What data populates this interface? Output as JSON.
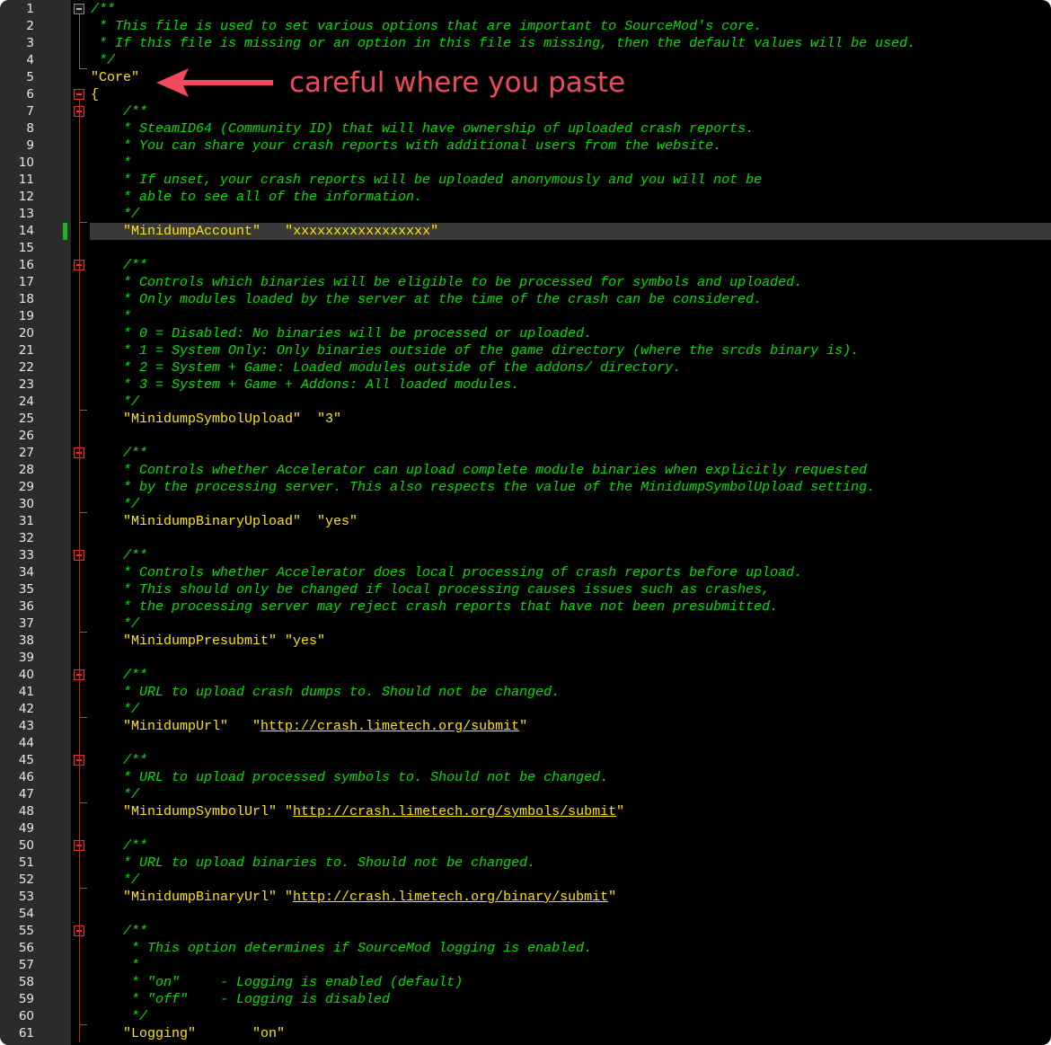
{
  "editor": {
    "annotation": "careful where you paste",
    "current_line": 14,
    "lines": [
      {
        "n": "1",
        "parts": [
          {
            "t": "/**",
            "c": "comment"
          }
        ]
      },
      {
        "n": "2",
        "parts": [
          {
            "t": " * This file is used to set various options that are important to SourceMod's core.",
            "c": "comment"
          }
        ]
      },
      {
        "n": "3",
        "parts": [
          {
            "t": " * If this file is missing or an option in this file is missing, then the default values will be used.",
            "c": "comment"
          }
        ]
      },
      {
        "n": "4",
        "parts": [
          {
            "t": " */",
            "c": "comment"
          }
        ]
      },
      {
        "n": "5",
        "parts": [
          {
            "t": "\"Core\"",
            "c": "str"
          }
        ]
      },
      {
        "n": "6",
        "parts": [
          {
            "t": "{",
            "c": "punc"
          }
        ]
      },
      {
        "n": "7",
        "parts": [
          {
            "t": "    /**",
            "c": "comment"
          }
        ]
      },
      {
        "n": "8",
        "parts": [
          {
            "t": "    * SteamID64 (Community ID) that will have ownership of uploaded crash reports.",
            "c": "comment"
          }
        ]
      },
      {
        "n": "9",
        "parts": [
          {
            "t": "    * You can share your crash reports with additional users from the website.",
            "c": "comment"
          }
        ]
      },
      {
        "n": "10",
        "parts": [
          {
            "t": "    *",
            "c": "comment"
          }
        ]
      },
      {
        "n": "11",
        "parts": [
          {
            "t": "    * If unset, your crash reports will be uploaded anonymously and you will not be",
            "c": "comment"
          }
        ]
      },
      {
        "n": "12",
        "parts": [
          {
            "t": "    * able to see all of the information.",
            "c": "comment"
          }
        ]
      },
      {
        "n": "13",
        "parts": [
          {
            "t": "    */",
            "c": "comment"
          }
        ]
      },
      {
        "n": "14",
        "parts": [
          {
            "t": "    ",
            "c": "str"
          },
          {
            "t": "\"MinidumpAccount\"",
            "c": "str"
          },
          {
            "t": "   ",
            "c": "str"
          },
          {
            "t": "\"xxxxxxxxxxxxxxxxx\"",
            "c": "str"
          }
        ]
      },
      {
        "n": "15",
        "parts": []
      },
      {
        "n": "16",
        "parts": [
          {
            "t": "    /**",
            "c": "comment"
          }
        ]
      },
      {
        "n": "17",
        "parts": [
          {
            "t": "    * Controls which binaries will be eligible to be processed for symbols and uploaded.",
            "c": "comment"
          }
        ]
      },
      {
        "n": "18",
        "parts": [
          {
            "t": "    * Only modules loaded by the server at the time of the crash can be considered.",
            "c": "comment"
          }
        ]
      },
      {
        "n": "19",
        "parts": [
          {
            "t": "    *",
            "c": "comment"
          }
        ]
      },
      {
        "n": "20",
        "parts": [
          {
            "t": "    * 0 = Disabled: No binaries will be processed or uploaded.",
            "c": "comment"
          }
        ]
      },
      {
        "n": "21",
        "parts": [
          {
            "t": "    * 1 = System Only: Only binaries outside of the game directory (where the srcds binary is).",
            "c": "comment"
          }
        ]
      },
      {
        "n": "22",
        "parts": [
          {
            "t": "    * 2 = System + Game: Loaded modules outside of the addons/ directory.",
            "c": "comment"
          }
        ]
      },
      {
        "n": "23",
        "parts": [
          {
            "t": "    * 3 = System + Game + Addons: All loaded modules.",
            "c": "comment"
          }
        ]
      },
      {
        "n": "24",
        "parts": [
          {
            "t": "    */",
            "c": "comment"
          }
        ]
      },
      {
        "n": "25",
        "parts": [
          {
            "t": "    \"MinidumpSymbolUpload\"  \"3\"",
            "c": "str"
          }
        ]
      },
      {
        "n": "26",
        "parts": []
      },
      {
        "n": "27",
        "parts": [
          {
            "t": "    /**",
            "c": "comment"
          }
        ]
      },
      {
        "n": "28",
        "parts": [
          {
            "t": "    * Controls whether Accelerator can upload complete module binaries when explicitly requested",
            "c": "comment"
          }
        ]
      },
      {
        "n": "29",
        "parts": [
          {
            "t": "    * by the processing server. This also respects the value of the MinidumpSymbolUpload setting.",
            "c": "comment"
          }
        ]
      },
      {
        "n": "30",
        "parts": [
          {
            "t": "    */",
            "c": "comment"
          }
        ]
      },
      {
        "n": "31",
        "parts": [
          {
            "t": "    \"MinidumpBinaryUpload\"  \"yes\"",
            "c": "str"
          }
        ]
      },
      {
        "n": "32",
        "parts": []
      },
      {
        "n": "33",
        "parts": [
          {
            "t": "    /**",
            "c": "comment"
          }
        ]
      },
      {
        "n": "34",
        "parts": [
          {
            "t": "    * Controls whether Accelerator does local processing of crash reports before upload.",
            "c": "comment"
          }
        ]
      },
      {
        "n": "35",
        "parts": [
          {
            "t": "    * This should only be changed if local processing causes issues such as crashes,",
            "c": "comment"
          }
        ]
      },
      {
        "n": "36",
        "parts": [
          {
            "t": "    * the processing server may reject crash reports that have not been presubmitted.",
            "c": "comment"
          }
        ]
      },
      {
        "n": "37",
        "parts": [
          {
            "t": "    */",
            "c": "comment"
          }
        ]
      },
      {
        "n": "38",
        "parts": [
          {
            "t": "    \"MinidumpPresubmit\" \"yes\"",
            "c": "str"
          }
        ]
      },
      {
        "n": "39",
        "parts": []
      },
      {
        "n": "40",
        "parts": [
          {
            "t": "    /**",
            "c": "comment"
          }
        ]
      },
      {
        "n": "41",
        "parts": [
          {
            "t": "    * URL to upload crash dumps to. Should not be changed.",
            "c": "comment"
          }
        ]
      },
      {
        "n": "42",
        "parts": [
          {
            "t": "    */",
            "c": "comment"
          }
        ]
      },
      {
        "n": "43",
        "parts": [
          {
            "t": "    \"MinidumpUrl\"   \"",
            "c": "str"
          },
          {
            "t": "http://crash.limetech.org/submit",
            "c": "link"
          },
          {
            "t": "\"",
            "c": "str"
          }
        ]
      },
      {
        "n": "44",
        "parts": []
      },
      {
        "n": "45",
        "parts": [
          {
            "t": "    /**",
            "c": "comment"
          }
        ]
      },
      {
        "n": "46",
        "parts": [
          {
            "t": "    * URL to upload processed symbols to. Should not be changed.",
            "c": "comment"
          }
        ]
      },
      {
        "n": "47",
        "parts": [
          {
            "t": "    */",
            "c": "comment"
          }
        ]
      },
      {
        "n": "48",
        "parts": [
          {
            "t": "    \"MinidumpSymbolUrl\" \"",
            "c": "str"
          },
          {
            "t": "http://crash.limetech.org/symbols/submit",
            "c": "link"
          },
          {
            "t": "\"",
            "c": "str"
          }
        ]
      },
      {
        "n": "49",
        "parts": []
      },
      {
        "n": "50",
        "parts": [
          {
            "t": "    /**",
            "c": "comment"
          }
        ]
      },
      {
        "n": "51",
        "parts": [
          {
            "t": "    * URL to upload binaries to. Should not be changed.",
            "c": "comment"
          }
        ]
      },
      {
        "n": "52",
        "parts": [
          {
            "t": "    */",
            "c": "comment"
          }
        ]
      },
      {
        "n": "53",
        "parts": [
          {
            "t": "    \"MinidumpBinaryUrl\" \"",
            "c": "str"
          },
          {
            "t": "http://crash.limetech.org/binary/submit",
            "c": "link"
          },
          {
            "t": "\"",
            "c": "str"
          }
        ]
      },
      {
        "n": "54",
        "parts": []
      },
      {
        "n": "55",
        "parts": [
          {
            "t": "    /**",
            "c": "comment"
          }
        ]
      },
      {
        "n": "56",
        "parts": [
          {
            "t": "     * This option determines if SourceMod logging is enabled.",
            "c": "comment"
          }
        ]
      },
      {
        "n": "57",
        "parts": [
          {
            "t": "     *",
            "c": "comment"
          }
        ]
      },
      {
        "n": "58",
        "parts": [
          {
            "t": "     * \"on\"     - Logging is enabled (default)",
            "c": "comment"
          }
        ]
      },
      {
        "n": "59",
        "parts": [
          {
            "t": "     * \"off\"    - Logging is disabled",
            "c": "comment"
          }
        ]
      },
      {
        "n": "60",
        "parts": [
          {
            "t": "     */",
            "c": "comment"
          }
        ]
      },
      {
        "n": "61",
        "parts": [
          {
            "t": "    \"Logging\"       \"on\"",
            "c": "str"
          }
        ]
      }
    ]
  }
}
